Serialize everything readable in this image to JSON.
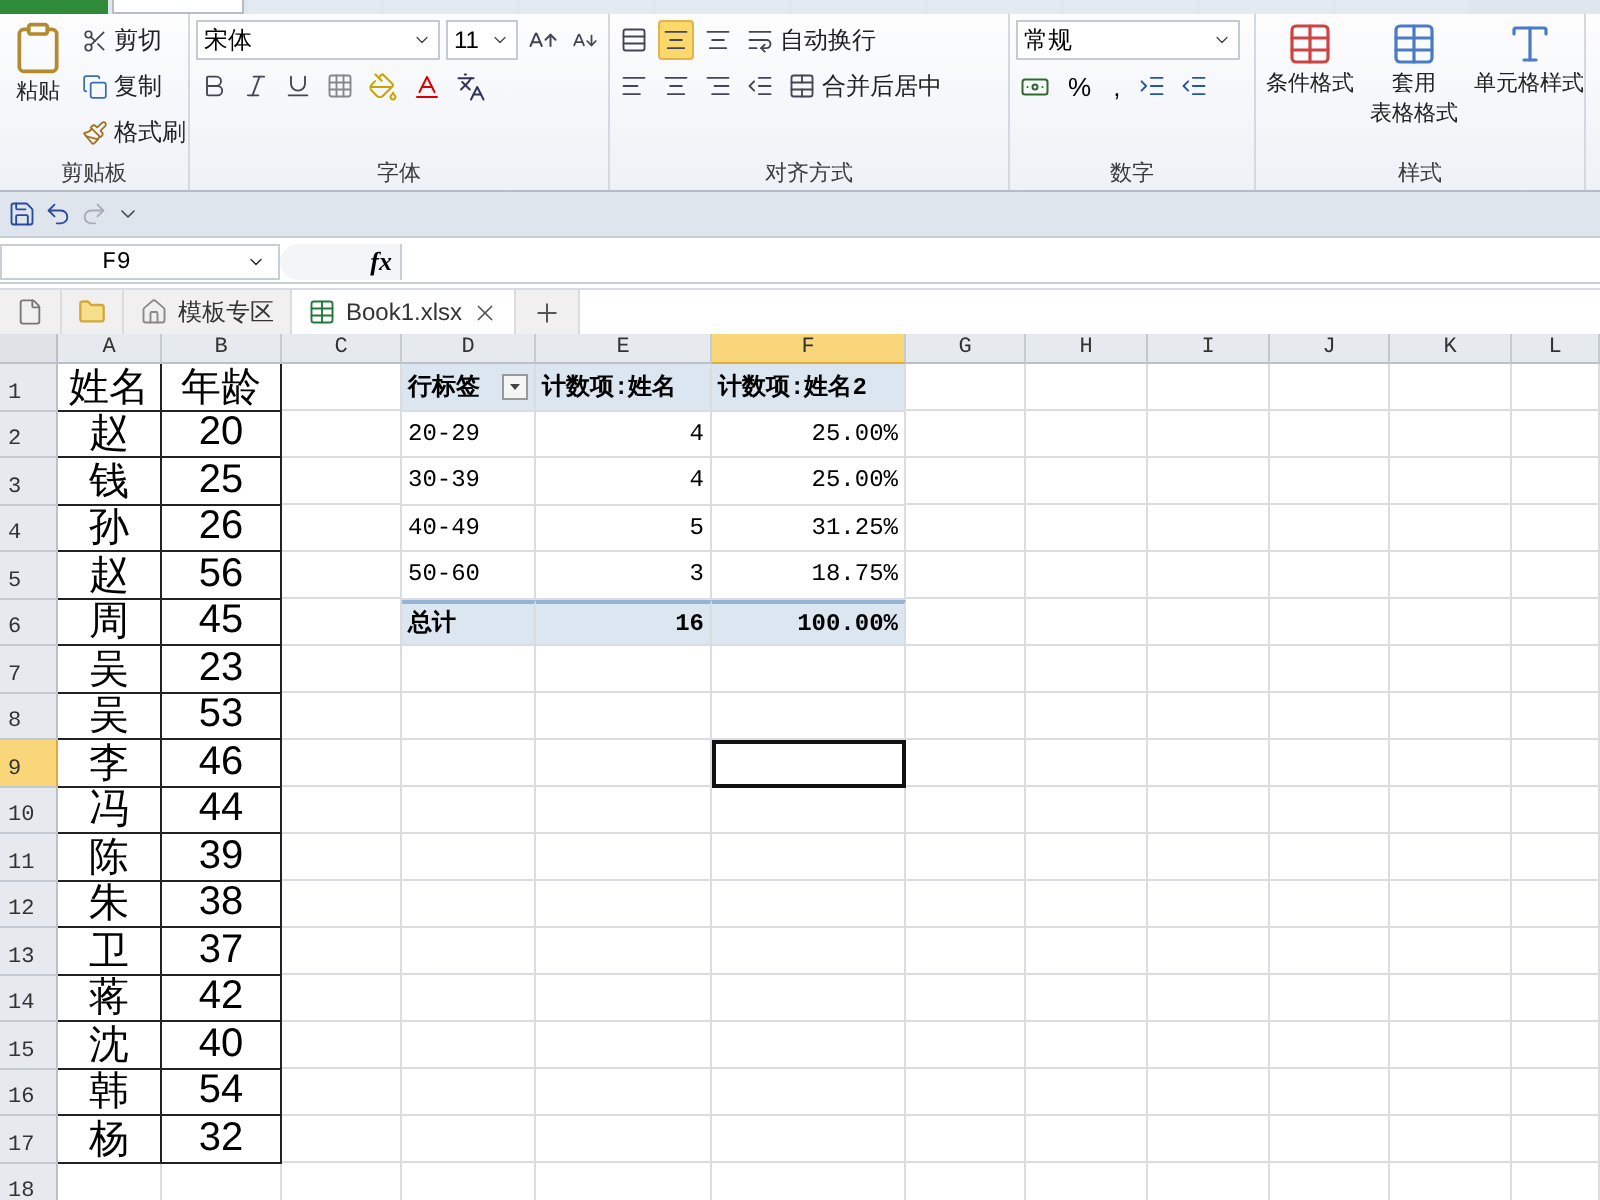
{
  "ribbon_tabs": [
    {
      "kind": "file",
      "selected": false
    },
    {
      "kind": "tab",
      "selected": true
    },
    {
      "kind": "tab",
      "selected": false
    },
    {
      "kind": "tab",
      "selected": false
    },
    {
      "kind": "tab",
      "selected": false
    },
    {
      "kind": "tab",
      "selected": false
    },
    {
      "kind": "tab",
      "selected": false
    },
    {
      "kind": "tab",
      "selected": false
    },
    {
      "kind": "tab",
      "selected": false
    },
    {
      "kind": "tab",
      "selected": false
    },
    {
      "kind": "tab",
      "selected": false
    }
  ],
  "clipboard": {
    "paste": "粘贴",
    "cut": "剪切",
    "copy": "复制",
    "format_painter": "格式刷",
    "label": "剪贴板"
  },
  "font": {
    "font_name": "宋体",
    "font_size": "11",
    "label": "字体"
  },
  "alignment": {
    "center_selected": true,
    "wrap_text": "自动换行",
    "merge_center": "合并后居中",
    "label": "对齐方式"
  },
  "number": {
    "format": "常规",
    "percent": "%",
    "comma": ",",
    "label": "数字"
  },
  "styles": {
    "conditional": "条件格式",
    "table_format_line1": "套用",
    "table_format_line2": "表格格式",
    "cell_styles": "单元格样式",
    "label": "样式"
  },
  "formula_bar": {
    "name_box": "F9",
    "fx": "fx"
  },
  "doc_tabs": [
    {
      "label": "模板专区",
      "kind": "template",
      "selected": false
    },
    {
      "label": "Book1.xlsx",
      "kind": "workbook",
      "selected": true
    }
  ],
  "columns": [
    {
      "name": "A",
      "kind": "roster",
      "selected": false
    },
    {
      "name": "B",
      "kind": "roster",
      "selected": false
    },
    {
      "name": "C",
      "selected": false
    },
    {
      "name": "D",
      "kind": "pivot-label",
      "selected": false
    },
    {
      "name": "E",
      "kind": "pivot-value",
      "selected": false
    },
    {
      "name": "F",
      "kind": "pivot-value",
      "selected": true
    },
    {
      "name": "G",
      "selected": false
    },
    {
      "name": "H",
      "selected": false
    },
    {
      "name": "I",
      "selected": false
    },
    {
      "name": "J",
      "selected": false
    },
    {
      "name": "K",
      "selected": false
    },
    {
      "name": "L",
      "selected": false
    }
  ],
  "rows": [
    {
      "number": "1",
      "selected": false,
      "kind": "header",
      "cells": {
        "A": "姓名",
        "B": "年龄",
        "D": "行标签",
        "E": "计数项:姓名",
        "F": "计数项:姓名2"
      }
    },
    {
      "number": "2",
      "selected": false,
      "kind": "item",
      "cells": {
        "A": "赵",
        "B": "20",
        "D": "20-29",
        "E": "4",
        "F": "25.00%"
      }
    },
    {
      "number": "3",
      "selected": false,
      "kind": "item",
      "cells": {
        "A": "钱",
        "B": "25",
        "D": "30-39",
        "E": "4",
        "F": "25.00%"
      }
    },
    {
      "number": "4",
      "selected": false,
      "kind": "item",
      "cells": {
        "A": "孙",
        "B": "26",
        "D": "40-49",
        "E": "5",
        "F": "31.25%"
      }
    },
    {
      "number": "5",
      "selected": false,
      "kind": "item",
      "cells": {
        "A": "赵",
        "B": "56",
        "D": "50-60",
        "E": "3",
        "F": "18.75%"
      }
    },
    {
      "number": "6",
      "selected": false,
      "kind": "total",
      "cells": {
        "A": "周",
        "B": "45",
        "D": "总计",
        "E": "16",
        "F": "100.00%"
      }
    },
    {
      "number": "7",
      "selected": false,
      "cells": {
        "A": "吴",
        "B": "23"
      }
    },
    {
      "number": "8",
      "selected": false,
      "cells": {
        "A": "吴",
        "B": "53"
      }
    },
    {
      "number": "9",
      "selected": true,
      "cells": {
        "A": "李",
        "B": "46"
      }
    },
    {
      "number": "10",
      "selected": false,
      "cells": {
        "A": "冯",
        "B": "44"
      }
    },
    {
      "number": "11",
      "selected": false,
      "cells": {
        "A": "陈",
        "B": "39"
      }
    },
    {
      "number": "12",
      "selected": false,
      "cells": {
        "A": "朱",
        "B": "38"
      }
    },
    {
      "number": "13",
      "selected": false,
      "cells": {
        "A": "卫",
        "B": "37"
      }
    },
    {
      "number": "14",
      "selected": false,
      "cells": {
        "A": "蒋",
        "B": "42"
      }
    },
    {
      "number": "15",
      "selected": false,
      "cells": {
        "A": "沈",
        "B": "40"
      }
    },
    {
      "number": "16",
      "selected": false,
      "cells": {
        "A": "韩",
        "B": "54"
      }
    },
    {
      "number": "17",
      "selected": false,
      "cells": {
        "A": "杨",
        "B": "32"
      }
    },
    {
      "number": "18",
      "selected": false,
      "cells": {}
    }
  ]
}
